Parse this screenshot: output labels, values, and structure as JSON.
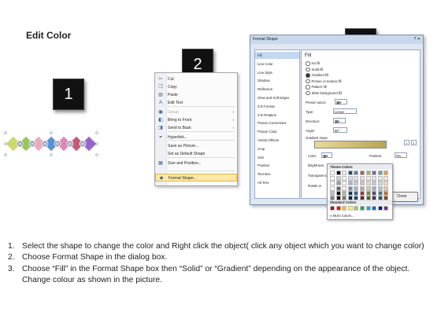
{
  "title": "Edit Color",
  "badges": [
    "1",
    "2",
    "3"
  ],
  "context_menu": {
    "items": [
      {
        "label": "Cut",
        "icon": "scissors-icon",
        "glyph": "✂",
        "disabled": false,
        "arrow": false
      },
      {
        "label": "Copy",
        "icon": "copy-icon",
        "glyph": "❐",
        "disabled": false,
        "arrow": false
      },
      {
        "label": "Paste",
        "icon": "paste-icon",
        "glyph": "▤",
        "disabled": false,
        "arrow": false
      },
      {
        "label": "Edit Text",
        "icon": "edit-text-icon",
        "glyph": "A",
        "disabled": false,
        "arrow": false
      },
      {
        "label": "Group",
        "icon": "group-icon",
        "glyph": "▣",
        "disabled": true,
        "arrow": true
      },
      {
        "label": "Bring to Front",
        "icon": "bring-front-icon",
        "glyph": "◧",
        "disabled": false,
        "arrow": true
      },
      {
        "label": "Send to Back",
        "icon": "send-back-icon",
        "glyph": "◨",
        "disabled": false,
        "arrow": true
      },
      {
        "label": "Hyperlink...",
        "icon": "hyperlink-icon",
        "glyph": "⚭",
        "disabled": false,
        "arrow": false
      },
      {
        "label": "Save as Picture...",
        "icon": "",
        "glyph": "",
        "disabled": false,
        "arrow": false
      },
      {
        "label": "Set as Default Shape",
        "icon": "",
        "glyph": "",
        "disabled": false,
        "arrow": false
      },
      {
        "label": "Size and Position...",
        "icon": "size-icon",
        "glyph": "▦",
        "disabled": false,
        "arrow": false
      },
      {
        "label": "Format Shape...",
        "icon": "format-shape-icon",
        "glyph": "◆",
        "disabled": false,
        "arrow": false
      }
    ]
  },
  "dialog": {
    "title": "Format Shape",
    "title_buttons": "? ✕",
    "nav": [
      "Fill",
      "Line Color",
      "Line Style",
      "Shadow",
      "Reflection",
      "Glow and Soft Edges",
      "3-D Format",
      "3-D Rotation",
      "Picture Corrections",
      "Picture Color",
      "Artistic Effects",
      "Crop",
      "Size",
      "Position",
      "Text Box",
      "Alt Text"
    ],
    "selected_nav": "Fill",
    "pane_heading": "Fill",
    "fill_options": [
      "No fill",
      "Solid fill",
      "Gradient fill",
      "Picture or texture fill",
      "Pattern fill",
      "Slide background fill"
    ],
    "selected_fill": "Gradient fill",
    "preset_label": "Preset colors:",
    "type_label": "Type:",
    "type_value": "Linear",
    "direction_label": "Direction:",
    "angle_label": "Angle:",
    "angle_value": "90°",
    "gradient_stops_label": "Gradient stops",
    "color_label": "Color",
    "position_label": "Position:",
    "position_value": "0%",
    "brightness_label": "Brightness",
    "transparency_label": "Transparency",
    "rotate_label": "Rotate w",
    "close_label": "Close"
  },
  "color_popup": {
    "theme_header": "Theme Colors",
    "standard_header": "Standard Colors",
    "more_label": "More Colors...",
    "theme_top": [
      "#ffffff",
      "#000000",
      "#eeece1",
      "#1f497d",
      "#4f81bd",
      "#c0504d",
      "#9bbb59",
      "#8064a2",
      "#4bacc6",
      "#f79646"
    ],
    "standard": [
      "#c00000",
      "#ff0000",
      "#ffc000",
      "#ffff00",
      "#92d050",
      "#00b050",
      "#00b0f0",
      "#0070c0",
      "#002060",
      "#7030a0"
    ]
  },
  "instructions": [
    {
      "num": "1.",
      "text": "Select the shape to change the color and Right click the object( click any object which you want to change color)"
    },
    {
      "num": "2.",
      "text": "Choose Format Shape in the dialog box."
    },
    {
      "num": "3.",
      "text": "Choose “Fill” in the Format Shape box then “Solid” or “Gradient” depending on the appearance of the object. Change colour as shown in the picture."
    }
  ],
  "shape_colors": [
    "#c9d65a",
    "#8bc34a",
    "#e9a2b8",
    "#4a86d8",
    "#e07ab0",
    "#c2476a",
    "#8b56c8"
  ]
}
